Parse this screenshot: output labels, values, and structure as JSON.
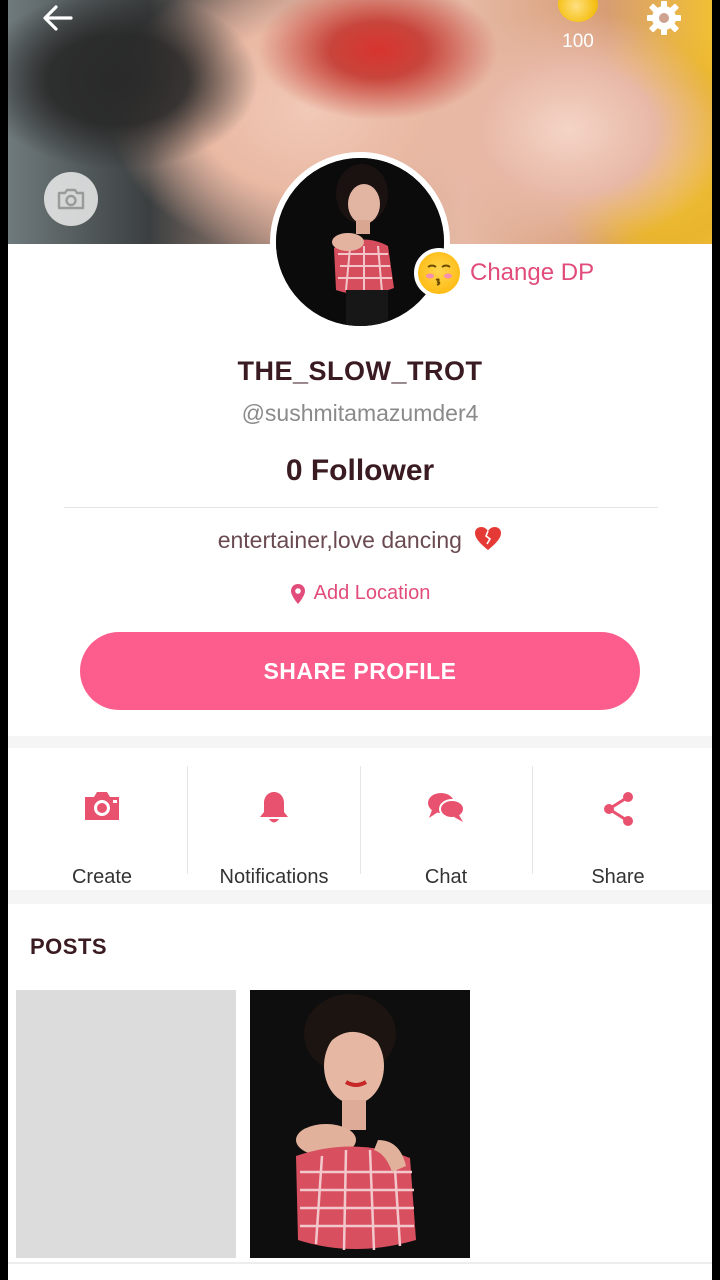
{
  "header": {
    "back_icon": "arrow-left-icon",
    "coins": "100",
    "settings_icon": "gear-icon",
    "cover_camera_icon": "camera-icon"
  },
  "profile": {
    "change_dp_label": "Change DP",
    "change_dp_emoji": "kissing-face-emoji",
    "name": "THE_SLOW_TROT",
    "handle": "@sushmitamazumder4",
    "followers": "0 Follower",
    "bio": "entertainer,love dancing",
    "bio_emoji": "heart-emoji",
    "location_label": "Add Location",
    "share_button": "SHARE PROFILE"
  },
  "actions": [
    {
      "label": "Create",
      "icon": "camera-icon"
    },
    {
      "label": "Notifications",
      "icon": "bell-icon"
    },
    {
      "label": "Chat",
      "icon": "chat-bubbles-icon"
    },
    {
      "label": "Share",
      "icon": "share-icon"
    }
  ],
  "posts": {
    "title": "POSTS"
  },
  "colors": {
    "accent": "#fc5d8c",
    "accent_text": "#e24c7a",
    "title_text": "#3a1b22"
  }
}
